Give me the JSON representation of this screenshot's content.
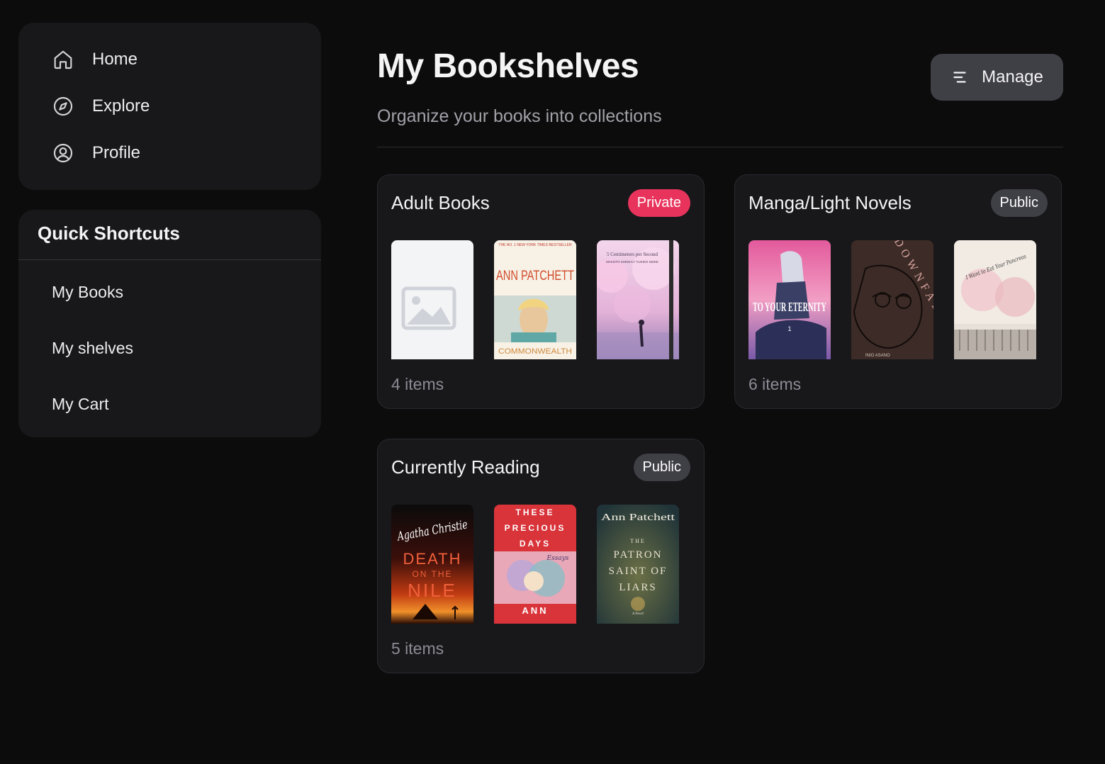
{
  "nav": {
    "items": [
      {
        "label": "Home",
        "icon": "home-icon"
      },
      {
        "label": "Explore",
        "icon": "compass-icon"
      },
      {
        "label": "Profile",
        "icon": "user-circle-icon"
      }
    ]
  },
  "shortcuts": {
    "title": "Quick Shortcuts",
    "items": [
      "My Books",
      "My shelves",
      "My Cart"
    ]
  },
  "header": {
    "title": "My Bookshelves",
    "subtitle": "Organize your books into collections",
    "manage_label": "Manage"
  },
  "shelves": [
    {
      "name": "Adult Books",
      "visibility": "Private",
      "count": "4 items",
      "covers": [
        {
          "type": "placeholder"
        },
        {
          "type": "book",
          "top_text": "THE NO. 1 NEW YORK TIMES BESTSELLER",
          "author": "ANN PATCHETT",
          "title": "COMMONWEALTH"
        },
        {
          "type": "book",
          "title": "5 Centimeters per Second",
          "credits": "MAKOTO SHINKAI / YUKIKO SEIKE"
        }
      ]
    },
    {
      "name": "Manga/Light Novels",
      "visibility": "Public",
      "count": "6 items",
      "covers": [
        {
          "type": "book",
          "title": "TO YOUR ETERNITY",
          "volume": "1"
        },
        {
          "type": "book",
          "title": "DOWNFALL",
          "credits": "INIO ASANO"
        },
        {
          "type": "book",
          "title": "I Want to Eat Your Pancreas"
        }
      ]
    },
    {
      "name": "Currently Reading",
      "visibility": "Public",
      "count": "5 items",
      "covers": [
        {
          "type": "book",
          "author": "Agatha Christie",
          "title_line1": "DEATH",
          "title_line2": "ON THE",
          "title_line3": "NILE"
        },
        {
          "type": "book",
          "title_line1": "THESE",
          "title_line2": "PRECIOUS",
          "title_line3": "DAYS",
          "subtitle": "Essays",
          "author": "ANN"
        },
        {
          "type": "book",
          "author": "Ann Patchett",
          "title_line1": "THE",
          "title_line2": "PATRON",
          "title_line3": "SAINT OF",
          "title_line4": "LIARS",
          "subtitle": "A Novel"
        }
      ]
    }
  ],
  "colors": {
    "background": "#0c0c0d",
    "panel": "#18181b",
    "private_badge": "#e8345c",
    "public_badge": "#3f3f46",
    "button": "#3f3f46"
  }
}
